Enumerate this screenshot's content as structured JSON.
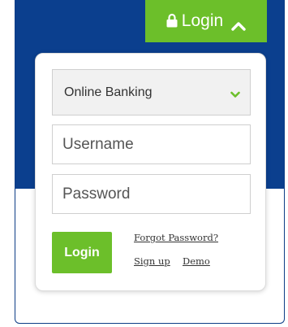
{
  "header": {
    "login_toggle_label": "Login",
    "accent_color": "#6cbf2a",
    "band_color": "#0b3f8e"
  },
  "form": {
    "account_type": "Online Banking",
    "username_placeholder": "Username",
    "password_placeholder": "Password",
    "submit_label": "Login",
    "forgot_password": "Forgot Password?",
    "sign_up": "Sign up",
    "demo": "Demo"
  },
  "icons": {
    "lock": "lock-icon",
    "toggle_chevron": "chevron-up-icon",
    "select_chevron": "chevron-down-icon"
  }
}
